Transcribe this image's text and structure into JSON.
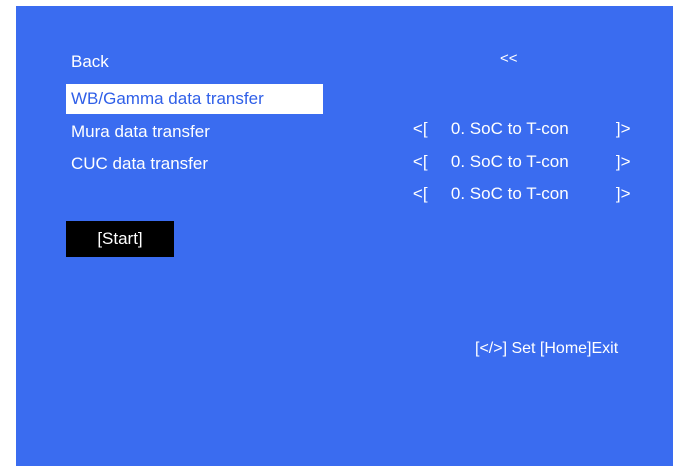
{
  "menu": {
    "back": {
      "label": "Back",
      "value": "<<"
    },
    "items": [
      {
        "label": "WB/Gamma data transfer",
        "open": "<[",
        "value": "0. SoC to T-con",
        "close": "]>",
        "selected": true
      },
      {
        "label": "Mura data transfer",
        "open": "<[",
        "value": "0. SoC to T-con",
        "close": "]>",
        "selected": false
      },
      {
        "label": "CUC data transfer",
        "open": "<[",
        "value": "0. SoC to T-con",
        "close": "]>",
        "selected": false
      }
    ]
  },
  "start_button": {
    "label": "[Start]"
  },
  "footer": {
    "hint": "[</>] Set [Home]Exit"
  },
  "colors": {
    "background": "#3a6cf0",
    "highlight": "#ffffff",
    "button": "#000000"
  }
}
